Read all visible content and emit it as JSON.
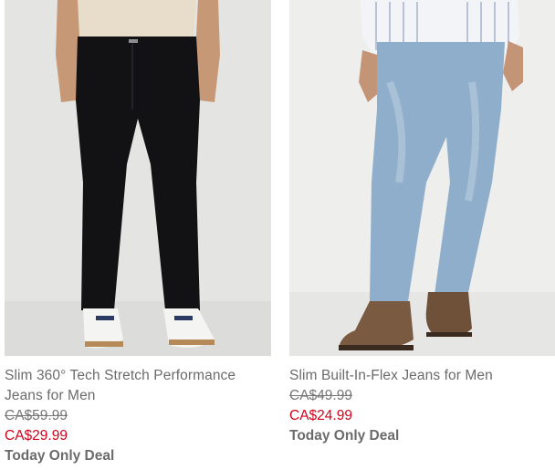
{
  "products": [
    {
      "title": "Slim 360° Tech Stretch Performance Jeans for Men",
      "was_price": "CA$59.99",
      "sale_price": "CA$29.99",
      "badge": "Today Only Deal",
      "image": "black-slim-jeans-photo"
    },
    {
      "title": "Slim Built-In-Flex Jeans for Men",
      "was_price": "CA$49.99",
      "sale_price": "CA$24.99",
      "badge": "Today Only Deal",
      "image": "light-wash-slim-jeans-photo"
    }
  ],
  "colors": {
    "sale": "#d0021b",
    "text": "#6b6b6b",
    "strike": "#777777"
  }
}
